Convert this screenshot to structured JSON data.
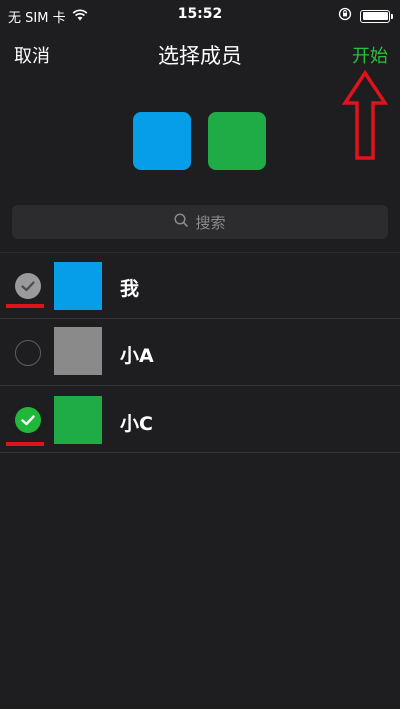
{
  "status_bar": {
    "carrier": "无 SIM 卡",
    "time": "15:52",
    "icons": [
      "wifi-icon",
      "orientation-lock-icon",
      "battery-icon"
    ]
  },
  "nav": {
    "cancel_label": "取消",
    "title": "选择成员",
    "start_label": "开始"
  },
  "selected_members": [
    {
      "color": "#069ee8"
    },
    {
      "color": "#1fab46"
    }
  ],
  "search": {
    "placeholder": "搜索",
    "icon": "search-icon"
  },
  "members": [
    {
      "name": "我",
      "state": "disabled",
      "avatar_color": "#069ee8",
      "icon": "checkmark-icon"
    },
    {
      "name": "小A",
      "state": "unchecked",
      "avatar_color": "#8a8a8a"
    },
    {
      "name": "小C",
      "state": "checked",
      "avatar_color": "#1fab46",
      "icon": "checkmark-icon"
    }
  ],
  "colors": {
    "background": "#1e1d20",
    "accent_green": "#2dbd3c",
    "annotation_red": "#e0121c"
  }
}
